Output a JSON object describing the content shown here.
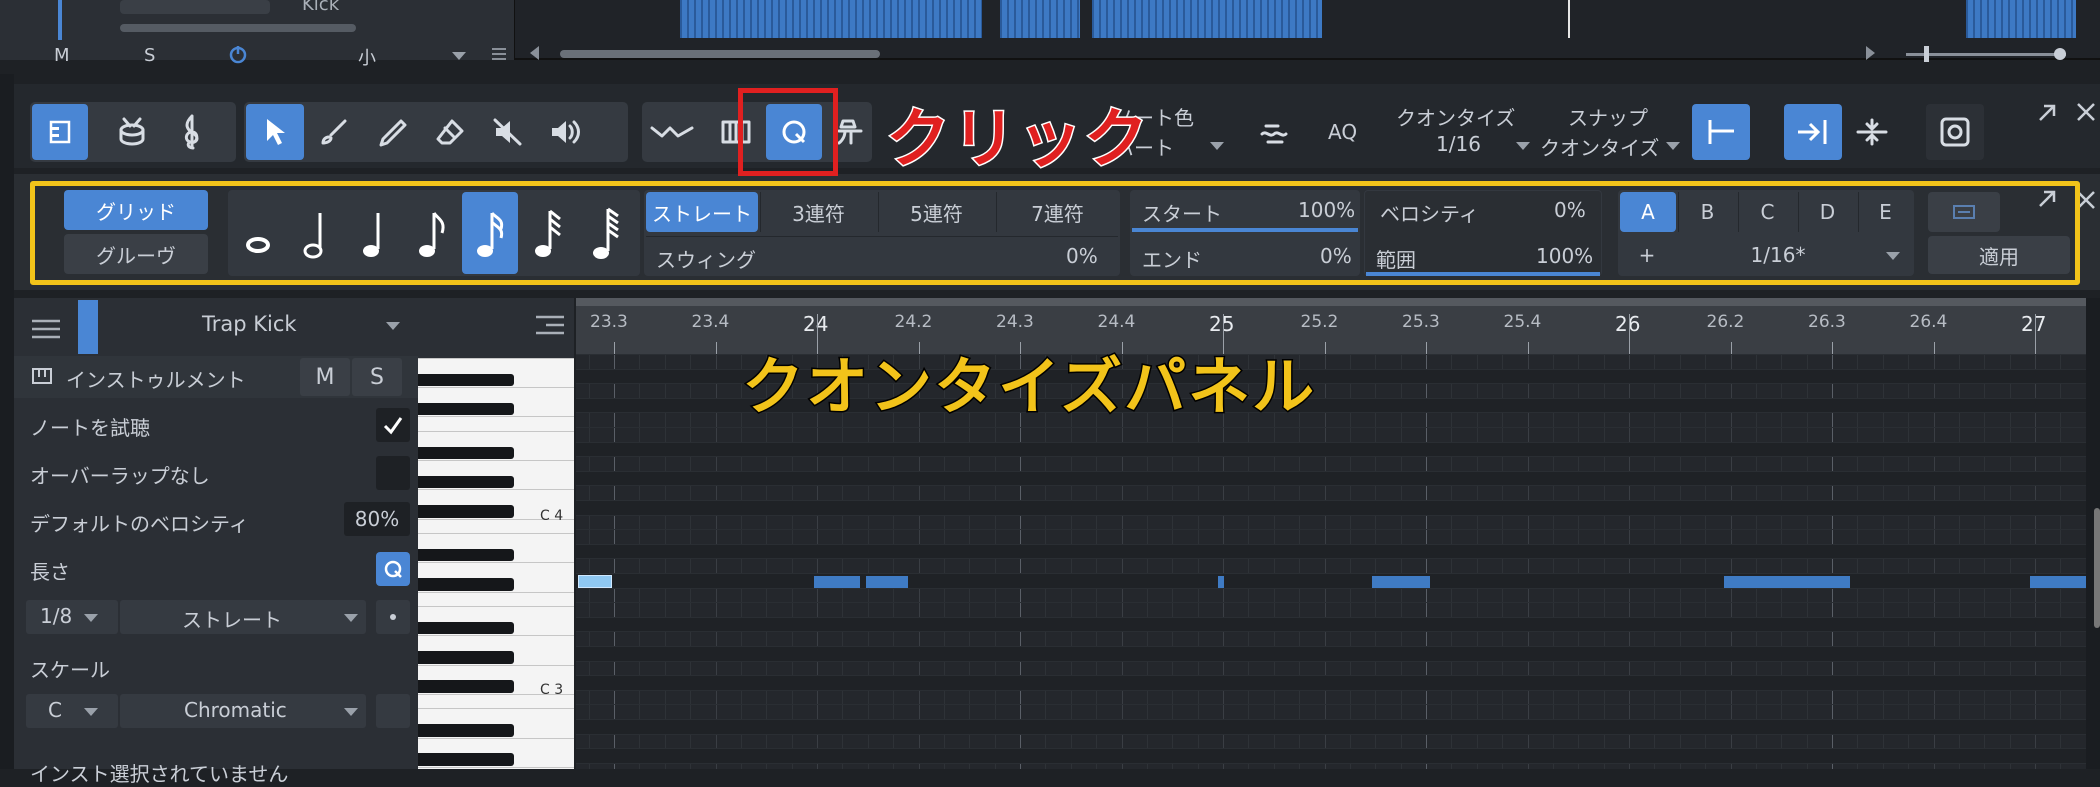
{
  "top_track": {
    "name": "Kick",
    "m": "M",
    "s": "S",
    "size": "小"
  },
  "toolbar": {
    "note_color_label": "ノート色",
    "note_color_value": "パート",
    "aq": "AQ",
    "quantize_label": "クオンタイズ",
    "quantize_value": "1/16",
    "snap_label": "スナップ",
    "snap_value": "クオンタイズ"
  },
  "annotations": {
    "click": "クリック",
    "quantize_panel": "クオンタイズパネル"
  },
  "qpanel": {
    "grid": "グリッド",
    "groove": "グルーヴ",
    "straight": "ストレート",
    "triplet3": "3連符",
    "triplet5": "5連符",
    "triplet7": "7連符",
    "swing": "スウィング",
    "swing_value": "0%",
    "start": "スタート",
    "start_value": "100%",
    "end": "エンド",
    "end_value": "0%",
    "velocity": "ベロシティ",
    "velocity_value": "0%",
    "range": "範囲",
    "range_value": "100%",
    "slots": [
      "A",
      "B",
      "C",
      "D",
      "E"
    ],
    "plus": "+",
    "slot_value": "1/16*",
    "apply": "適用",
    "start_fill": 1.0,
    "range_fill": 1.0
  },
  "inspector": {
    "track_name": "Trap Kick",
    "instrument": "インストゥルメント",
    "m": "M",
    "s": "S",
    "audition": "ノートを試聴",
    "overlap": "オーバーラップなし",
    "default_velocity": "デフォルトのベロシティ",
    "default_velocity_value": "80%",
    "length": "長さ",
    "length_value": "1/8",
    "length_mode": "ストレート",
    "scale": "スケール",
    "scale_root": "C",
    "scale_type": "Chromatic",
    "bottom_cut": "インスト選択されていません"
  },
  "ruler": [
    "23.3",
    "23.4",
    "24",
    "24.2",
    "24.3",
    "24.4",
    "25",
    "25.2",
    "25.3",
    "25.4",
    "26",
    "26.2",
    "26.3",
    "26.4",
    "27"
  ],
  "piano": {
    "c4": "C 4",
    "c3": "C 3"
  },
  "colors": {
    "accent": "#4a86d4",
    "highlight": "#f2c31a",
    "red": "#e02020",
    "note": "#3f7bc4"
  }
}
